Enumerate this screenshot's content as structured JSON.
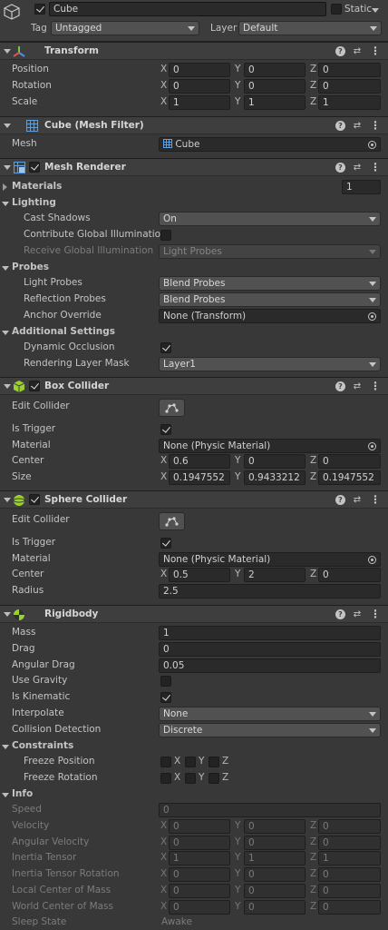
{
  "header": {
    "object_name": "Cube",
    "static_label": "Static",
    "tag_label": "Tag",
    "tag_value": "Untagged",
    "layer_label": "Layer",
    "layer_value": "Default"
  },
  "transform": {
    "title": "Transform",
    "rows": [
      {
        "label": "Position",
        "x": "0",
        "y": "0",
        "z": "0"
      },
      {
        "label": "Rotation",
        "x": "0",
        "y": "0",
        "z": "0"
      },
      {
        "label": "Scale",
        "x": "1",
        "y": "1",
        "z": "1"
      }
    ]
  },
  "mesh_filter": {
    "title": "Cube (Mesh Filter)",
    "mesh_label": "Mesh",
    "mesh_value": "Cube"
  },
  "mesh_renderer": {
    "title": "Mesh Renderer",
    "materials_label": "Materials",
    "materials_count": "1",
    "lighting_label": "Lighting",
    "cast_shadows_label": "Cast Shadows",
    "cast_shadows_value": "On",
    "contribute_gi_label": "Contribute Global Illumination",
    "receive_gi_label": "Receive Global Illumination",
    "receive_gi_value": "Light Probes",
    "probes_label": "Probes",
    "light_probes_label": "Light Probes",
    "light_probes_value": "Blend Probes",
    "reflection_probes_label": "Reflection Probes",
    "reflection_probes_value": "Blend Probes",
    "anchor_override_label": "Anchor Override",
    "anchor_override_value": "None (Transform)",
    "additional_label": "Additional Settings",
    "dynamic_occlusion_label": "Dynamic Occlusion",
    "rendering_layer_mask_label": "Rendering Layer Mask",
    "rendering_layer_mask_value": "Layer1"
  },
  "box_collider": {
    "title": "Box Collider",
    "edit_collider_label": "Edit Collider",
    "is_trigger_label": "Is Trigger",
    "material_label": "Material",
    "material_value": "None (Physic Material)",
    "center_label": "Center",
    "center": {
      "x": "0.6",
      "y": "0",
      "z": "0"
    },
    "size_label": "Size",
    "size": {
      "x": "0.1947552",
      "y": "0.9433212",
      "z": "0.1947552"
    }
  },
  "sphere_collider": {
    "title": "Sphere Collider",
    "edit_collider_label": "Edit Collider",
    "is_trigger_label": "Is Trigger",
    "material_label": "Material",
    "material_value": "None (Physic Material)",
    "center_label": "Center",
    "center": {
      "x": "0.5",
      "y": "2",
      "z": "0"
    },
    "radius_label": "Radius",
    "radius_value": "2.5"
  },
  "rigidbody": {
    "title": "Rigidbody",
    "mass_label": "Mass",
    "mass_value": "1",
    "drag_label": "Drag",
    "drag_value": "0",
    "angular_drag_label": "Angular Drag",
    "angular_drag_value": "0.05",
    "use_gravity_label": "Use Gravity",
    "is_kinematic_label": "Is Kinematic",
    "interpolate_label": "Interpolate",
    "interpolate_value": "None",
    "collision_detection_label": "Collision Detection",
    "collision_detection_value": "Discrete",
    "constraints_label": "Constraints",
    "freeze_position_label": "Freeze Position",
    "freeze_rotation_label": "Freeze Rotation",
    "info_label": "Info",
    "speed_label": "Speed",
    "speed_value": "0",
    "info_rows": [
      {
        "label": "Velocity",
        "x": "0",
        "y": "0",
        "z": "0"
      },
      {
        "label": "Angular Velocity",
        "x": "0",
        "y": "0",
        "z": "0"
      },
      {
        "label": "Inertia Tensor",
        "x": "1",
        "y": "1",
        "z": "1"
      },
      {
        "label": "Inertia Tensor Rotation",
        "x": "0",
        "y": "0",
        "z": "0"
      },
      {
        "label": "Local Center of Mass",
        "x": "0",
        "y": "0",
        "z": "0"
      },
      {
        "label": "World Center of Mass",
        "x": "0",
        "y": "0",
        "z": "0"
      }
    ],
    "sleep_state_label": "Sleep State",
    "sleep_state_value": "Awake"
  },
  "axes": {
    "x": "X",
    "y": "Y",
    "z": "Z"
  },
  "colors": {
    "background": "#383838",
    "field": "#2a2a2a",
    "header": "#3e3e3e",
    "accent_green": "#9ad12f"
  }
}
